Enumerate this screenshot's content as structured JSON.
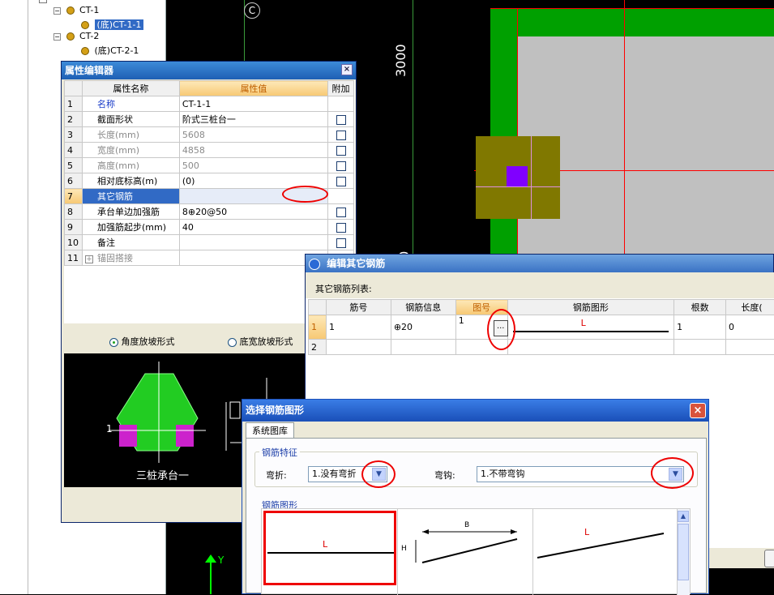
{
  "tree": {
    "items": [
      {
        "label": "CT-1",
        "level": 1
      },
      {
        "label": "(底)CT-1-1",
        "level": 2,
        "selected": true
      },
      {
        "label": "CT-2",
        "level": 1
      },
      {
        "label": "(底)CT-2-1",
        "level": 2
      }
    ]
  },
  "cad": {
    "axis_label": "C",
    "dim_top": "3000",
    "dim_bottom": "00",
    "colors": {
      "green": "#00a000",
      "gray": "#c0c0c0",
      "olive": "#807800",
      "purple": "#8000ff"
    }
  },
  "prop_editor": {
    "title": "属性编辑器",
    "close": "×",
    "headers": {
      "name": "属性名称",
      "value": "属性值",
      "extra": "附加"
    },
    "rows": [
      {
        "no": "1",
        "name": "名称",
        "value": "CT-1-1",
        "style": "blue",
        "check": false
      },
      {
        "no": "2",
        "name": "截面形状",
        "value": "阶式三桩台一",
        "style": "",
        "check": true
      },
      {
        "no": "3",
        "name": "长度(mm)",
        "value": "5608",
        "style": "gray",
        "check": true
      },
      {
        "no": "4",
        "name": "宽度(mm)",
        "value": "4858",
        "style": "gray",
        "check": true
      },
      {
        "no": "5",
        "name": "高度(mm)",
        "value": "500",
        "style": "gray",
        "check": true
      },
      {
        "no": "6",
        "name": "相对底标高(m)",
        "value": "(0)",
        "style": "",
        "check": true
      },
      {
        "no": "7",
        "name": "其它钢筋",
        "value": "",
        "style": "selected",
        "check": false
      },
      {
        "no": "8",
        "name": "承台单边加强筋",
        "value": "8⊕20@50",
        "style": "",
        "check": true
      },
      {
        "no": "9",
        "name": "加强筋起步(mm)",
        "value": "40",
        "style": "",
        "check": true
      },
      {
        "no": "10",
        "name": "备注",
        "value": "",
        "style": "",
        "check": true
      },
      {
        "no": "11",
        "name": "锚固搭接",
        "value": "",
        "style": "gray",
        "check": false,
        "expander": "+"
      }
    ],
    "radio1": "角度放坡形式",
    "radio2": "底宽放坡形式",
    "preview_caption": "三桩承台一",
    "preview_dim": "1"
  },
  "other_rebar": {
    "title": "编辑其它钢筋",
    "list_label": "其它钢筋列表:",
    "headers": [
      "筋号",
      "钢筋信息",
      "图号",
      "钢筋图形",
      "根数",
      "长度("
    ],
    "rows": [
      {
        "no": "1",
        "jinhao": "1",
        "info": "⊕20",
        "tuhao": "1",
        "shape_label": "L",
        "count": "1",
        "length": "0"
      },
      {
        "no": "2",
        "jinhao": "",
        "info": "",
        "tuhao": "",
        "shape_label": "",
        "count": "",
        "length": ""
      }
    ],
    "ellipsis": "..."
  },
  "select_shape": {
    "title": "选择钢筋图形",
    "close": "×",
    "tab": "系统图库",
    "group1": "钢筋特征",
    "bend_label": "弯折:",
    "bend_value": "1.没有弯折",
    "hook_label": "弯钩:",
    "hook_value": "1.不带弯钩",
    "group2": "钢筋图形",
    "shapes": [
      {
        "label": "L"
      },
      {
        "label_b": "B",
        "label_h": "H"
      },
      {
        "label": "L"
      }
    ]
  },
  "axis": {
    "y": "Y"
  }
}
